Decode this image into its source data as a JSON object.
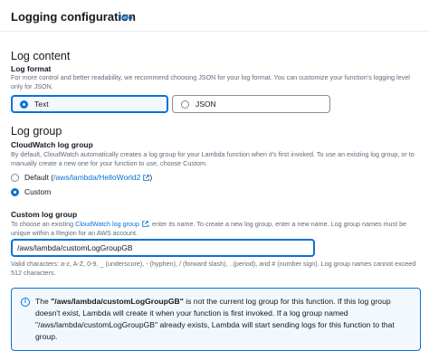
{
  "header": {
    "title": "Logging configuration",
    "info": "Info"
  },
  "log_content": {
    "heading": "Log content",
    "format_label": "Log format",
    "format_desc": "For more control and better readability, we recommend choosing JSON for your log format. You can customize your function’s logging level only for JSON.",
    "options": [
      {
        "label": "Text",
        "selected": true
      },
      {
        "label": "JSON",
        "selected": false
      }
    ]
  },
  "log_group": {
    "heading": "Log group",
    "cw_label": "CloudWatch log group",
    "cw_desc": "By default, CloudWatch automatically creates a log group for your Lambda function when it’s first invoked. To use an existing log group, or to manually create a new one for your function to use, choose Custom.",
    "default_prefix": "Default (",
    "default_link": "/aws/lambda/HelloWorld2",
    "default_suffix": ")",
    "custom_label": "Custom",
    "custom_field_label": "Custom log group",
    "custom_desc_prefix": "To choose an existing ",
    "custom_desc_link": "CloudWatch log group",
    "custom_desc_suffix": ", enter its name. To create a new log group, enter a new name. Log group names must be unique within a Region for an AWS account.",
    "input_value": "/aws/lambda/customLogGroupGB",
    "constraint": "Valid characters: a-z, A-Z, 0-9, _ (underscore), - (hyphen), / (forward slash), . (period), and # (number sign). Log group names cannot exceed 512 characters."
  },
  "alert": {
    "prefix": "The ",
    "bold_name": "\"/aws/lambda/customLogGroupGB\"",
    "text": " is not the current log group for this function. If this log group doesn't exist, Lambda will create it when your function is first invoked. If a log group named \"/aws/lambda/customLogGroupGB\" already exists, Lambda will start sending logs for this function to that group."
  },
  "colors": {
    "accent": "#0972d3",
    "muted": "#5f6b7a",
    "selected_bg": "#f2f8fd"
  }
}
